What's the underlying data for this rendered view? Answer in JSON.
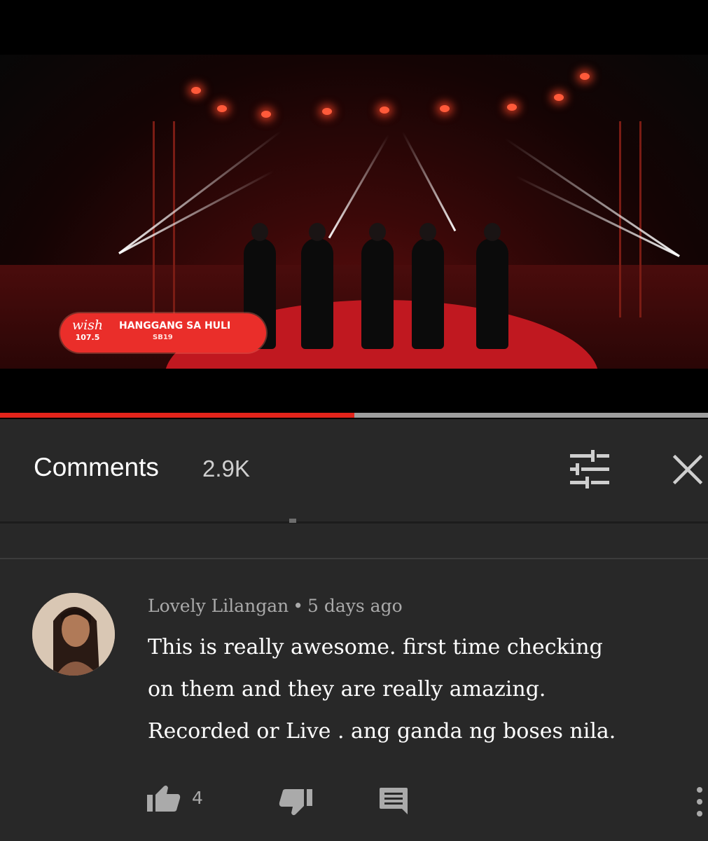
{
  "video": {
    "lower_third": {
      "brand": "wish",
      "frequency": "107.5",
      "song_title": "HANGGANG SA HULI",
      "artist": "SB19"
    },
    "progress_fraction": 0.5,
    "colors": {
      "progress": "#e3241b",
      "lower_third": "#ea2e2a"
    }
  },
  "comments_panel": {
    "title": "Comments",
    "count": "2.9K",
    "filter_icon": "sort-filter-icon",
    "close_icon": "close-icon"
  },
  "comment": {
    "author": "Lovely Lilangan",
    "separator": "•",
    "time": "5 days ago",
    "lines": [
      "This is really awesome. first time checking",
      "on them and they are really amazing.",
      "Recorded or Live . ang ganda ng boses nila."
    ],
    "like_count": "4",
    "icons": [
      "thumbs-up-icon",
      "thumbs-down-icon",
      "reply-icon",
      "more-vert-icon"
    ]
  }
}
